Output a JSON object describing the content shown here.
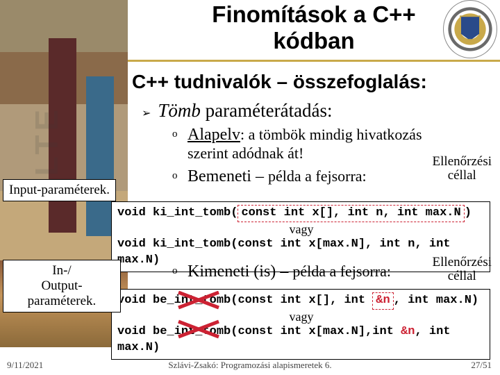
{
  "title_line1": "Finomítások a C++",
  "title_line2": "kódban",
  "subtitle": "C++ tudnivalók – összefoglalás:",
  "bullet1_em": "Tömb",
  "bullet1_rest": " paraméterátadás:",
  "sub1_u": "Alapelv",
  "sub1_rest": ": a tömbök mindig hivatkozás",
  "sub1_line2": "szerint adódnak át!",
  "sub2_head": "Bemeneti",
  "sub2_dash": " – ",
  "sub2_tail": "példa a fejsorra:",
  "sub3_head": "Kimeneti (is)",
  "sub3_dash": " – ",
  "sub3_tail": "példa a fejsorra:",
  "side1": "Input-paraméterek.",
  "side2_l1": "In-/",
  "side2_l2": "Output-paraméterek.",
  "ellen_l1": "Ellenőrzési",
  "ellen_l2": "céllal",
  "code1_a_pre": "void ki_int_tomb(",
  "code1_a_box": "const int x[], int n, int max.N",
  "code1_a_post": ")",
  "vagy": "vagy",
  "code1_b": "void ki_int_tomb(const int x[max.N], int n, int max.N)",
  "code2_a_pre": "void be_int_tomb(",
  "code2_a_const": "const",
  "code2_a_mid": " int x[], int ",
  "code2_a_amp": "&n",
  "code2_a_post": ", int max.N)",
  "code2_b_pre": "void be_int_tomb(",
  "code2_b_const": "const",
  "code2_b_mid": " int x[max.N],int ",
  "code2_b_amp": "&n",
  "code2_b_post": ", int max.N)",
  "watermark": "ELTE",
  "footer_date": "9/11/2021",
  "footer_mid": "Szlávi-Zsakó: Programozási alapismeretek 6.",
  "footer_page": "27/51"
}
